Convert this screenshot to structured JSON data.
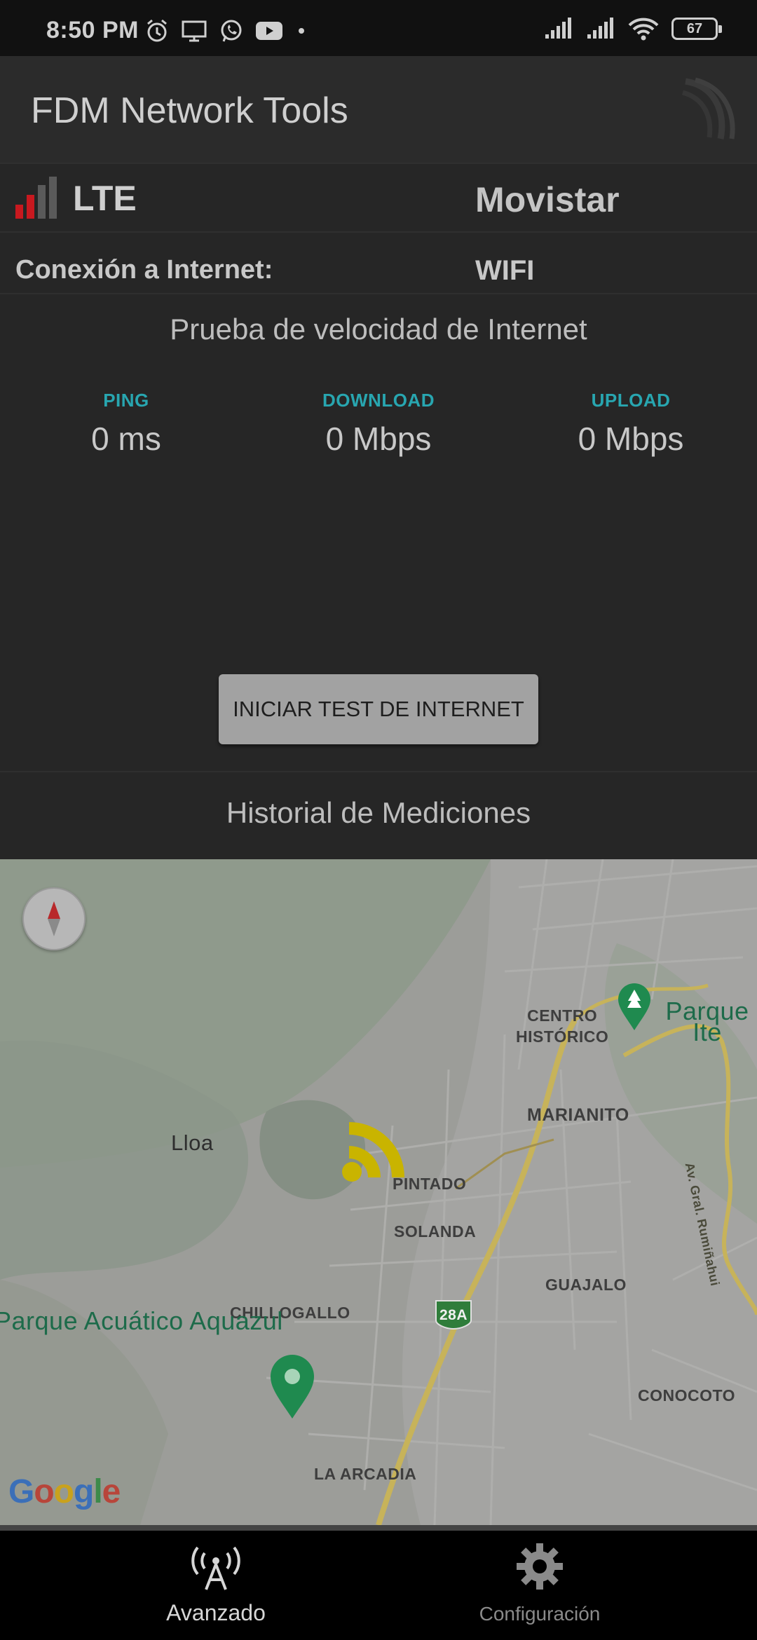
{
  "status_bar": {
    "time": "8:50 PM",
    "battery": "67",
    "icons_left": [
      "alarm-icon",
      "monitor-icon",
      "whatsapp-icon",
      "youtube-icon",
      "dot-icon"
    ],
    "icons_right": [
      "signal-icon",
      "signal-icon",
      "wifi-icon",
      "battery-icon"
    ]
  },
  "app_bar": {
    "title": "FDM Network Tools"
  },
  "network": {
    "technology": "LTE",
    "operator": "Movistar",
    "signal_level": 2,
    "signal_color": "#c8191f"
  },
  "connection": {
    "label": "Conexión a Internet:",
    "value": "WIFI"
  },
  "speed_test": {
    "title": "Prueba de velocidad de Internet",
    "ping": {
      "label": "PING",
      "value": "0 ms"
    },
    "download": {
      "label": "DOWNLOAD",
      "value": "0 Mbps"
    },
    "upload": {
      "label": "UPLOAD",
      "value": "0 Mbps"
    },
    "accent": "#28a6b0",
    "button_label": "INICIAR TEST DE INTERNET"
  },
  "history": {
    "label": "Historial de Mediciones"
  },
  "map": {
    "labels": {
      "centro_1": "CENTRO",
      "centro_2": "HISTÓRICO",
      "parque_ite": "Parque Ite",
      "marianito": "MARIANITO",
      "lloa": "Lloa",
      "pintado": "PINTADO",
      "solanda": "SOLANDA",
      "guajalo": "GUAJALO",
      "chillogallo": "CHILLOGALLO",
      "aquazul": "Parque Acuático Aquazul",
      "route": "28A",
      "conocoto": "CONOCOTO",
      "la_arcadia": "LA ARCADIA",
      "av_gral": "Av. Gral. Rumiñahui"
    },
    "google_logo": "Google",
    "marker_color": "#c9b400"
  },
  "bottom_nav": {
    "items": [
      {
        "label": "Avanzado",
        "icon": "antenna-icon",
        "active": true
      },
      {
        "label": "Configuración",
        "icon": "gear-icon",
        "active": false
      }
    ]
  }
}
